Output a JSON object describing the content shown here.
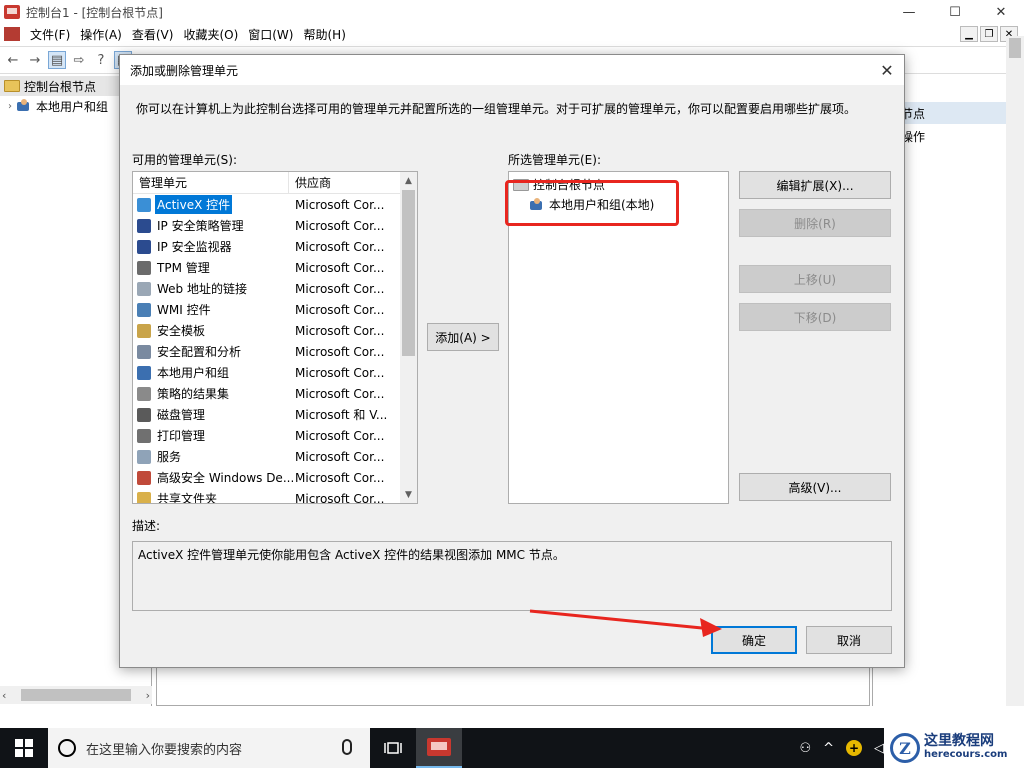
{
  "window": {
    "title": "控制台1 - [控制台根节点]",
    "controls": {
      "minimize": "—",
      "maximize": "☐",
      "close": "✕"
    }
  },
  "menubar": {
    "items": [
      "文件(F)",
      "操作(A)",
      "查看(V)",
      "收藏夹(O)",
      "窗口(W)",
      "帮助(H)"
    ],
    "mdi_controls": {
      "minimize": "▁",
      "restore": "❐",
      "close": "✕"
    }
  },
  "toolbar": {
    "back": "←",
    "forward": "→",
    "show_hide_tree": "▤",
    "export": "⇨",
    "help": "?",
    "properties": "▦"
  },
  "tree": {
    "root": "控制台根节点",
    "child": "本地用户和组"
  },
  "actions_pane": {
    "header": "台根节点",
    "more_actions": "更多操作",
    "more_arrow": "▶"
  },
  "left_scroll": {
    "left": "‹",
    "right": "›"
  },
  "dialog": {
    "title": "添加或删除管理单元",
    "close": "✕",
    "intro": "你可以在计算机上为此控制台选择可用的管理单元并配置所选的一组管理单元。对于可扩展的管理单元，你可以配置要启用哪些扩展项。",
    "available_label": "可用的管理单元(S):",
    "selected_label": "所选管理单元(E):",
    "columns": {
      "snapin": "管理单元",
      "vendor": "供应商"
    },
    "available_snapins": [
      {
        "name": "ActiveX 控件",
        "vendor": "Microsoft Cor...",
        "selected": true,
        "color": "#3a8fd6"
      },
      {
        "name": "IP 安全策略管理",
        "vendor": "Microsoft Cor...",
        "selected": false,
        "color": "#2b4b8f"
      },
      {
        "name": "IP 安全监视器",
        "vendor": "Microsoft Cor...",
        "selected": false,
        "color": "#2b4b8f"
      },
      {
        "name": "TPM 管理",
        "vendor": "Microsoft Cor...",
        "selected": false,
        "color": "#6b6b6b"
      },
      {
        "name": "Web 地址的链接",
        "vendor": "Microsoft Cor...",
        "selected": false,
        "color": "#9aa7b5"
      },
      {
        "name": "WMI 控件",
        "vendor": "Microsoft Cor...",
        "selected": false,
        "color": "#4a7fb5"
      },
      {
        "name": "安全模板",
        "vendor": "Microsoft Cor...",
        "selected": false,
        "color": "#c9a44a"
      },
      {
        "name": "安全配置和分析",
        "vendor": "Microsoft Cor...",
        "selected": false,
        "color": "#7a8aa0"
      },
      {
        "name": "本地用户和组",
        "vendor": "Microsoft Cor...",
        "selected": false,
        "color": "#3b6fb0"
      },
      {
        "name": "策略的结果集",
        "vendor": "Microsoft Cor...",
        "selected": false,
        "color": "#8a8a8a"
      },
      {
        "name": "磁盘管理",
        "vendor": "Microsoft 和 V...",
        "selected": false,
        "color": "#5a5a5a"
      },
      {
        "name": "打印管理",
        "vendor": "Microsoft Cor...",
        "selected": false,
        "color": "#707070"
      },
      {
        "name": "服务",
        "vendor": "Microsoft Cor...",
        "selected": false,
        "color": "#8fa3b8"
      },
      {
        "name": "高级安全 Windows De...",
        "vendor": "Microsoft Cor...",
        "selected": false,
        "color": "#c04a3a"
      },
      {
        "name": "共享文件夹",
        "vendor": "Microsoft Cor...",
        "selected": false,
        "color": "#d9b04a"
      }
    ],
    "add_button": "添加(A) >",
    "selected_tree": {
      "root": "控制台根节点",
      "child": "本地用户和组(本地)"
    },
    "side_buttons": {
      "edit_extensions": "编辑扩展(X)...",
      "remove": "删除(R)",
      "move_up": "上移(U)",
      "move_down": "下移(D)",
      "advanced": "高级(V)..."
    },
    "description_label": "描述:",
    "description_text": "ActiveX 控件管理单元使你能用包含 ActiveX 控件的结果视图添加 MMC 节点。",
    "ok": "确定",
    "cancel": "取消",
    "scroll": {
      "up": "▲",
      "down": "▼"
    }
  },
  "taskbar": {
    "search_placeholder": "在这里输入你要搜索的内容",
    "tray_person": "⚇",
    "tray_up": "^",
    "tray_badge": "+",
    "tray_volume": "◁"
  },
  "watermark": {
    "logo": "Z",
    "title": "这里教程网",
    "url": "herecours.com"
  },
  "annotation_color": "#e8261f"
}
